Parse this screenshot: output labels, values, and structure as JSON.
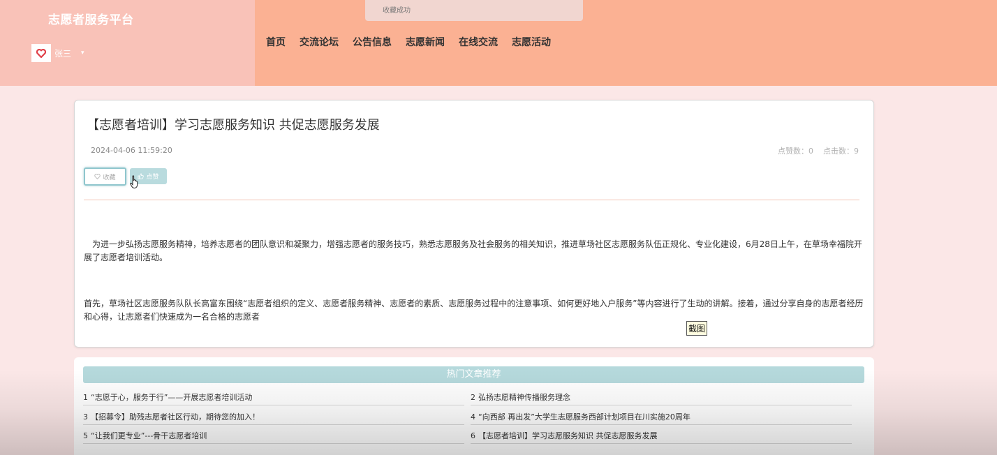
{
  "header": {
    "brand": "志愿者服务平台",
    "username": "张三",
    "caret": "▾",
    "nav": [
      "首页",
      "交流论坛",
      "公告信息",
      "志愿新闻",
      "在线交流",
      "志愿活动"
    ],
    "toast": "收藏成功",
    "colors": {
      "brand_bg": "#f9c2b8",
      "nav_bg": "#fbb193"
    }
  },
  "article": {
    "title": "【志愿者培训】学习志愿服务知识 共促志愿服务发展",
    "date": "2024-04-06 11:59:20",
    "likes_label": "点赞数：0",
    "clicks_label": "点击数：9",
    "fav_label": "收藏",
    "like_label": "点赞",
    "paragraphs": [
      "　为进一步弘扬志愿服务精神，培养志愿者的团队意识和凝聚力，增强志愿者的服务技巧，熟悉志愿服务及社会服务的相关知识，推进草场社区志愿服务队伍正规化、专业化建设，6月28日上午，在草场幸福院开展了志愿者培训活动。",
      "首先，草场社区志愿服务队队长高富东围绕“志愿者组织的定义、志愿者服务精神、志愿者的素质、志愿服务过程中的注意事项、如何更好地入户服务”等内容进行了生动的讲解。接着，通过分享自身的志愿者经历和心得，让志愿者们快速成为一名合格的志愿者"
    ]
  },
  "tooltip": "截图",
  "recommend": {
    "title": "热门文章推荐",
    "items": [
      {
        "num": "1",
        "text": "“志愿于心，服务于行”——开展志愿者培训活动"
      },
      {
        "num": "2",
        "text": "弘扬志愿精神传播服务理念"
      },
      {
        "num": "3",
        "text": "【招募令】助残志愿者社区行动，期待您的加入！"
      },
      {
        "num": "4",
        "text": "“向西部 再出发”大学生志愿服务西部计划项目在川实施20周年"
      },
      {
        "num": "5",
        "text": "“让我们更专业”---骨干志愿者培训"
      },
      {
        "num": "6",
        "text": "【志愿者培训】学习志愿服务知识 共促志愿服务发展"
      }
    ]
  }
}
